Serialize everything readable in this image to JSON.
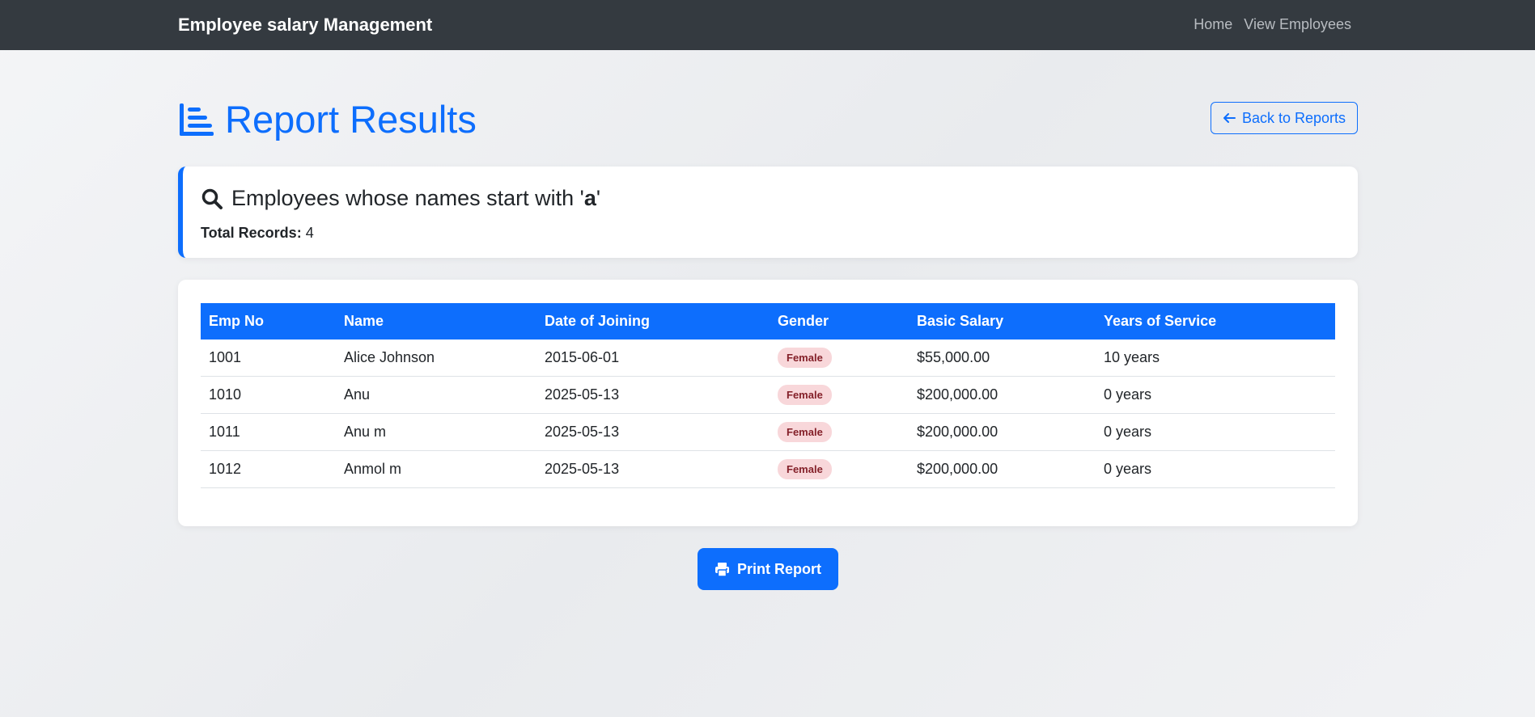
{
  "navbar": {
    "brand": "Employee salary Management",
    "links": [
      "Home",
      "View Employees"
    ]
  },
  "page": {
    "title": "Report Results",
    "title_icon": "chart-bars-icon",
    "back_button": "Back to Reports"
  },
  "info": {
    "heading_prefix": "Employees whose names start with '",
    "heading_letter": "a",
    "heading_suffix": "'",
    "total_label": "Total Records:",
    "total_value": "4"
  },
  "table": {
    "headers": [
      "Emp No",
      "Name",
      "Date of Joining",
      "Gender",
      "Basic Salary",
      "Years of Service"
    ],
    "rows": [
      [
        "1001",
        "Alice Johnson",
        "2015-06-01",
        "Female",
        "$55,000.00",
        "10 years"
      ],
      [
        "1010",
        "Anu",
        "2025-05-13",
        "Female",
        "$200,000.00",
        "0 years"
      ],
      [
        "1011",
        "Anu m",
        "2025-05-13",
        "Female",
        "$200,000.00",
        "0 years"
      ],
      [
        "1012",
        "Anmol m",
        "2025-05-13",
        "Female",
        "$200,000.00",
        "0 years"
      ]
    ]
  },
  "print_button": "Print Report",
  "colors": {
    "primary": "#0d6efd",
    "navbar": "#343a40",
    "badge_bg": "#f8d7da",
    "badge_text": "#842029"
  }
}
